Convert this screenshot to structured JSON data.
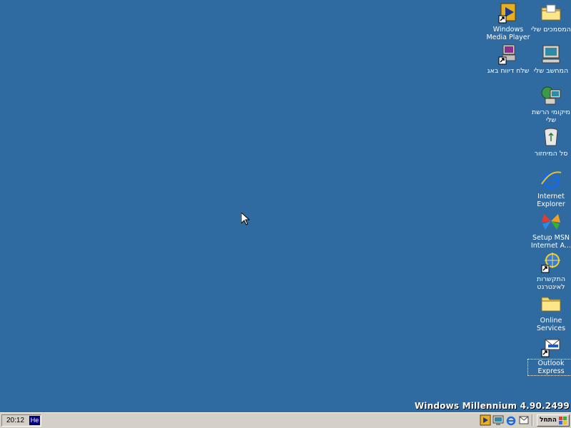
{
  "desktop": {
    "background": "#2f6aa1",
    "icons": [
      {
        "id": "my-documents",
        "label": "המסמכים שלי",
        "rtl": true
      },
      {
        "id": "windows-media-player",
        "label": "Windows Media Player",
        "rtl": false
      },
      {
        "id": "my-computer",
        "label": "המחשב שלי",
        "rtl": true
      },
      {
        "id": "send-bug-report",
        "label": "שלח דיווח באג",
        "rtl": true
      },
      {
        "id": "my-network-places",
        "label": "מיקומי הרשת שלי",
        "rtl": true
      },
      {
        "id": "recycle-bin",
        "label": "סל המיחזור",
        "rtl": true
      },
      {
        "id": "internet-explorer",
        "label": "Internet Explorer",
        "rtl": false
      },
      {
        "id": "setup-msn",
        "label": "Setup MSN Internet A...",
        "rtl": false
      },
      {
        "id": "connect-to-internet",
        "label": "התקשרות לאינטרנט",
        "rtl": true
      },
      {
        "id": "online-services",
        "label": "Online Services",
        "rtl": false
      },
      {
        "id": "outlook-express",
        "label": "Outlook Express",
        "rtl": false
      }
    ],
    "version_text": "Windows Millennium 4.90.2499"
  },
  "taskbar": {
    "clock": "20:12",
    "language": "He",
    "start_label": "התחל",
    "quick_launch": [
      "windows-media-player-icon",
      "show-desktop-icon",
      "internet-explorer-icon",
      "outlook-express-icon"
    ]
  },
  "colors": {
    "desktop": "#2f6aa1",
    "taskbar": "#d4d0c8",
    "language_indicator": "#000080"
  }
}
